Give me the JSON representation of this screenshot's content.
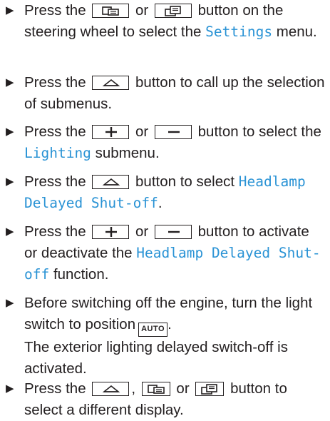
{
  "steps": [
    {
      "p1": "Press the",
      "or": "or",
      "p2": "button on the steering wheel to select the",
      "hl": "Settings",
      "p3": "menu."
    },
    {
      "p1": "Press the",
      "p2": "button to call up the selection of submenus."
    },
    {
      "p1": "Press the",
      "or": "or",
      "p2": "button to select the",
      "hl": "Lighting",
      "p3": "submenu."
    },
    {
      "p1": "Press the",
      "p2": "button to select",
      "hl": "Headlamp Delayed Shut-off",
      "p3": "."
    },
    {
      "p1": "Press the",
      "or": "or",
      "p2": "button to activate or deactivate the",
      "hl": "Headlamp Delayed Shut-off",
      "p3": "function."
    },
    {
      "p1": "Before switching off the engine, turn the light switch to position",
      "key": "AUTO",
      "p2": "The exterior lighting delayed switch-off is activated."
    },
    {
      "p1": "Press the",
      "comma": ",",
      "or": "or",
      "p2": "button to select a different display."
    }
  ],
  "icons": {
    "back": "display-back-icon",
    "forward": "display-forward-icon",
    "up": "home-up-icon",
    "plus": "plus-icon",
    "minus": "minus-icon"
  }
}
